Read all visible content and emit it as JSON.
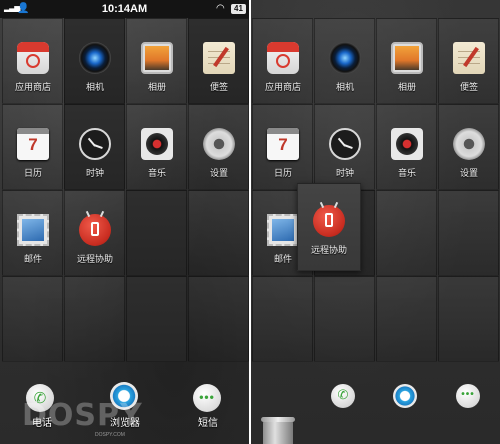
{
  "status_bar": {
    "time": "10:14AM",
    "battery": "41"
  },
  "left_screen": {
    "apps": [
      {
        "label": "应用商店",
        "icon": "app-store-icon"
      },
      {
        "label": "相机",
        "icon": "camera-icon"
      },
      {
        "label": "相册",
        "icon": "gallery-icon"
      },
      {
        "label": "便签",
        "icon": "notes-icon"
      },
      {
        "label": "日历",
        "icon": "calendar-icon",
        "badge": "7"
      },
      {
        "label": "时钟",
        "icon": "clock-icon"
      },
      {
        "label": "音乐",
        "icon": "music-icon"
      },
      {
        "label": "设置",
        "icon": "settings-icon"
      },
      {
        "label": "邮件",
        "icon": "mail-icon"
      },
      {
        "label": "远程协助",
        "icon": "remote-assist-icon"
      }
    ],
    "dock": [
      {
        "label": "电话",
        "icon": "phone-icon"
      },
      {
        "label": "浏览器",
        "icon": "browser-icon"
      },
      {
        "label": "短信",
        "icon": "sms-icon"
      }
    ]
  },
  "right_screen": {
    "apps": [
      {
        "label": "应用商店",
        "icon": "app-store-icon"
      },
      {
        "label": "相机",
        "icon": "camera-icon"
      },
      {
        "label": "相册",
        "icon": "gallery-icon"
      },
      {
        "label": "便签",
        "icon": "notes-icon"
      },
      {
        "label": "日历",
        "icon": "calendar-icon",
        "badge": "7"
      },
      {
        "label": "时钟",
        "icon": "clock-icon"
      },
      {
        "label": "音乐",
        "icon": "music-icon"
      },
      {
        "label": "设置",
        "icon": "settings-icon"
      },
      {
        "label": "邮件",
        "icon": "mail-icon"
      },
      {
        "label": "远程协助",
        "icon": "remote-assist-icon",
        "state": "dragging"
      }
    ],
    "dock": [
      {
        "icon": "phone-icon"
      },
      {
        "icon": "browser-icon"
      },
      {
        "icon": "sms-icon"
      }
    ],
    "trash_icon": "trash-icon"
  },
  "watermark": {
    "text": "DOSPY",
    "sub": "DOSPY.COM"
  }
}
